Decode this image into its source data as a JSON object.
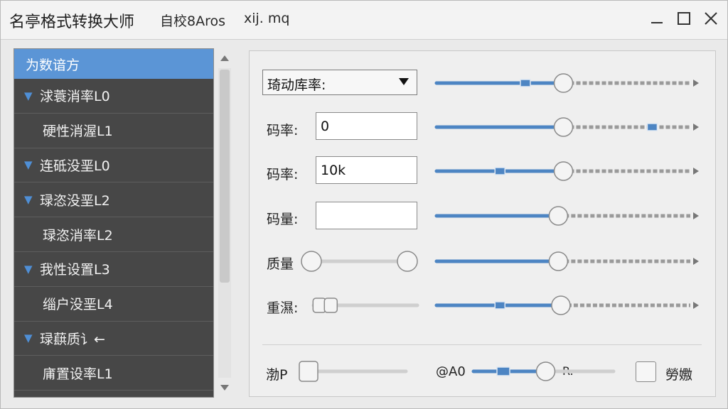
{
  "window": {
    "title": "名亭格式转换大师",
    "subtitle": "自校8Aros",
    "extra": "xij. mq",
    "controls": {
      "minimize": "minimize",
      "maximize": "maximize",
      "close": "close"
    }
  },
  "nav": {
    "items": [
      {
        "label": "为数谙方",
        "level": 0,
        "expanded": false,
        "selected": true
      },
      {
        "label": "浗蓑消率L0",
        "level": 0,
        "expanded": true,
        "selected": false
      },
      {
        "label": "硬性消渥L1",
        "level": 1,
        "selected": false
      },
      {
        "label": "连砥没垩L0",
        "level": 0,
        "expanded": true,
        "selected": false
      },
      {
        "label": "琭恣没垩L2",
        "level": 0,
        "expanded": true,
        "selected": false
      },
      {
        "label": "琭恣消率L2",
        "level": 1,
        "selected": false
      },
      {
        "label": "我性设置L3",
        "level": 0,
        "expanded": true,
        "selected": false
      },
      {
        "label": "缁户没垩L4",
        "level": 1,
        "selected": false
      },
      {
        "label": "琭蕻质讠←",
        "level": 0,
        "expanded": true,
        "selected": false
      },
      {
        "label": "庯置设率L1",
        "level": 1,
        "selected": false
      }
    ]
  },
  "panel": {
    "dropdown": {
      "value": "琦动库率:",
      "slider_level": 0.5
    },
    "rows": [
      {
        "label": "码率:",
        "value": "0",
        "slider_level": 0.5
      },
      {
        "label": "码率:",
        "value": "10k",
        "slider_level": 0.5
      },
      {
        "label": "码量:",
        "value": "",
        "slider_level": 0.48
      },
      {
        "label": "质量",
        "range_low": 0,
        "range_high": 1,
        "slider_level": 0.48
      },
      {
        "label": "重濕:",
        "stepper_level": 0.05,
        "slider_level": 0.49
      }
    ],
    "bottom": {
      "left_label": "渤P",
      "left_level": 0,
      "mid_label_left": "@A0",
      "mid_label_right": "R.",
      "mid_level": 0.5,
      "checkbox_label": "勞嫐",
      "checkbox_checked": false
    }
  },
  "colors": {
    "accent": "#5b95d6",
    "slider_track_blue": "#4d85c3",
    "slider_track_gray": "#9a9a9a",
    "nav_bg": "#474747"
  }
}
